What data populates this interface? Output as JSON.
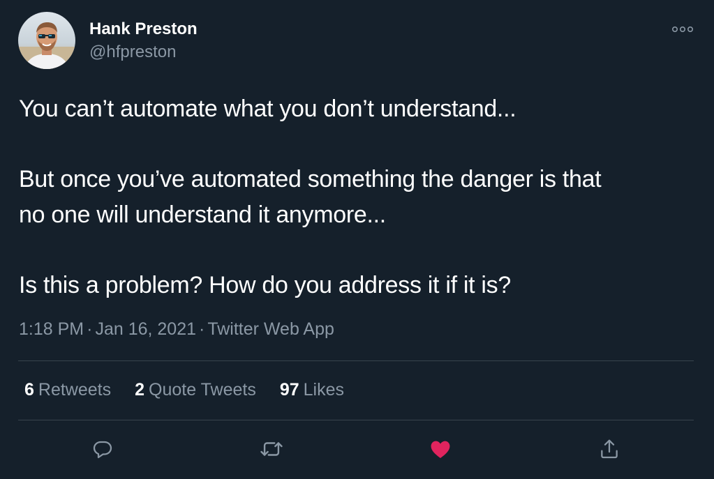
{
  "author": {
    "display_name": "Hank Preston",
    "handle": "@hfpreston"
  },
  "tweet": {
    "paragraphs": [
      "You can’t automate what you don’t understand...",
      "But once you’ve automated something the danger is that\nno one will understand it anymore...",
      "Is this a problem? How do you address it if it is?"
    ]
  },
  "meta": {
    "time": "1:18 PM",
    "date": "Jan 16, 2021",
    "source": "Twitter Web App",
    "separator": "·"
  },
  "stats": {
    "retweets": {
      "count": "6",
      "label": "Retweets"
    },
    "quotes": {
      "count": "2",
      "label": "Quote Tweets"
    },
    "likes": {
      "count": "97",
      "label": "Likes"
    }
  },
  "actions": {
    "reply": "reply-icon",
    "retweet": "retweet-icon",
    "like": "heart-icon",
    "share": "share-icon"
  },
  "colors": {
    "background": "#15202b",
    "secondary_text": "#8b98a5",
    "divider": "#38444d",
    "like_active": "#e0245e"
  }
}
